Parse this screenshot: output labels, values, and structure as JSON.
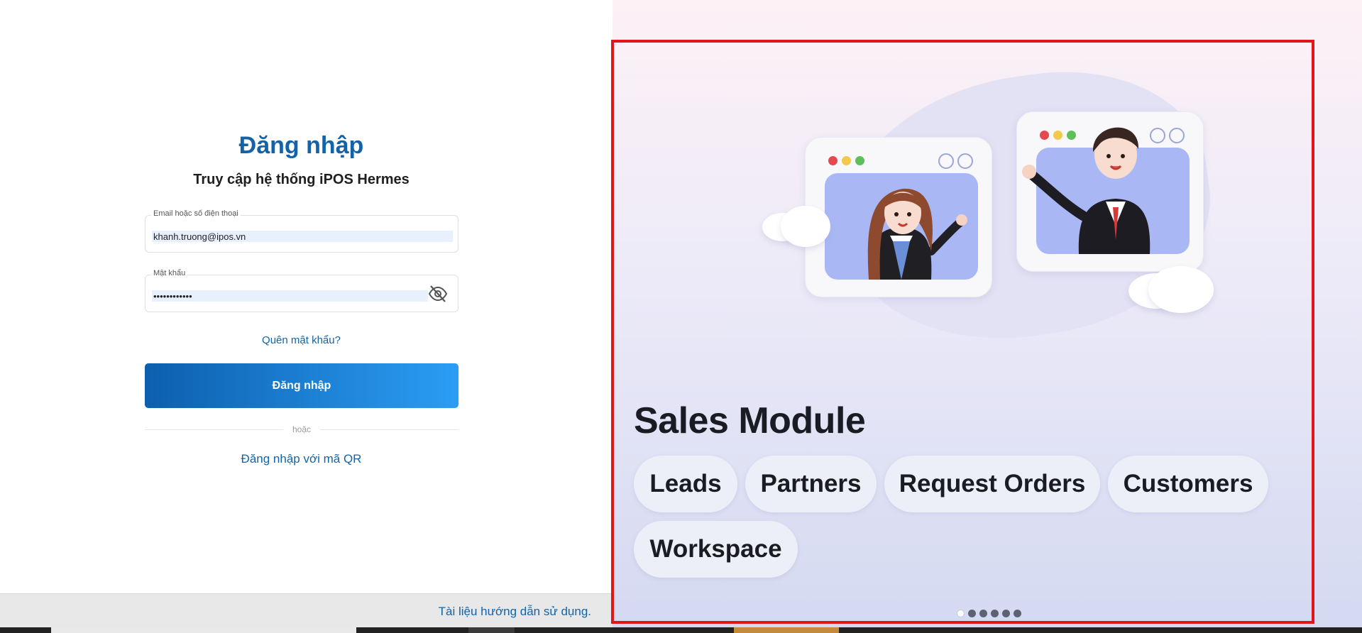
{
  "login": {
    "title": "Đăng nhập",
    "subtitle": "Truy cập hệ thống iPOS Hermes",
    "email_label": "Email hoặc số điện thoại",
    "email_value": "khanh.truong@ipos.vn",
    "password_label": "Mật khẩu",
    "password_value": "••••••••••••",
    "forgot_label": "Quên mật khẩu?",
    "submit_label": "Đăng nhập",
    "divider_text": "hoặc",
    "qr_label": "Đăng nhập với mã QR"
  },
  "footer": {
    "guide_link": "Tài liệu hướng dẫn sử dụng."
  },
  "showcase": {
    "title": "Sales Module",
    "chips": [
      "Leads",
      "Partners",
      "Request Orders",
      "Customers",
      "Workspace"
    ],
    "slide_count": 6,
    "active_slide": 1,
    "frame_color": "#e0161b"
  },
  "colors": {
    "brand_blue": "#1463a8",
    "button_gradient_start": "#0d5fae",
    "button_gradient_end": "#2a9df4"
  },
  "icons": {
    "password_toggle": "eye-off-icon"
  }
}
